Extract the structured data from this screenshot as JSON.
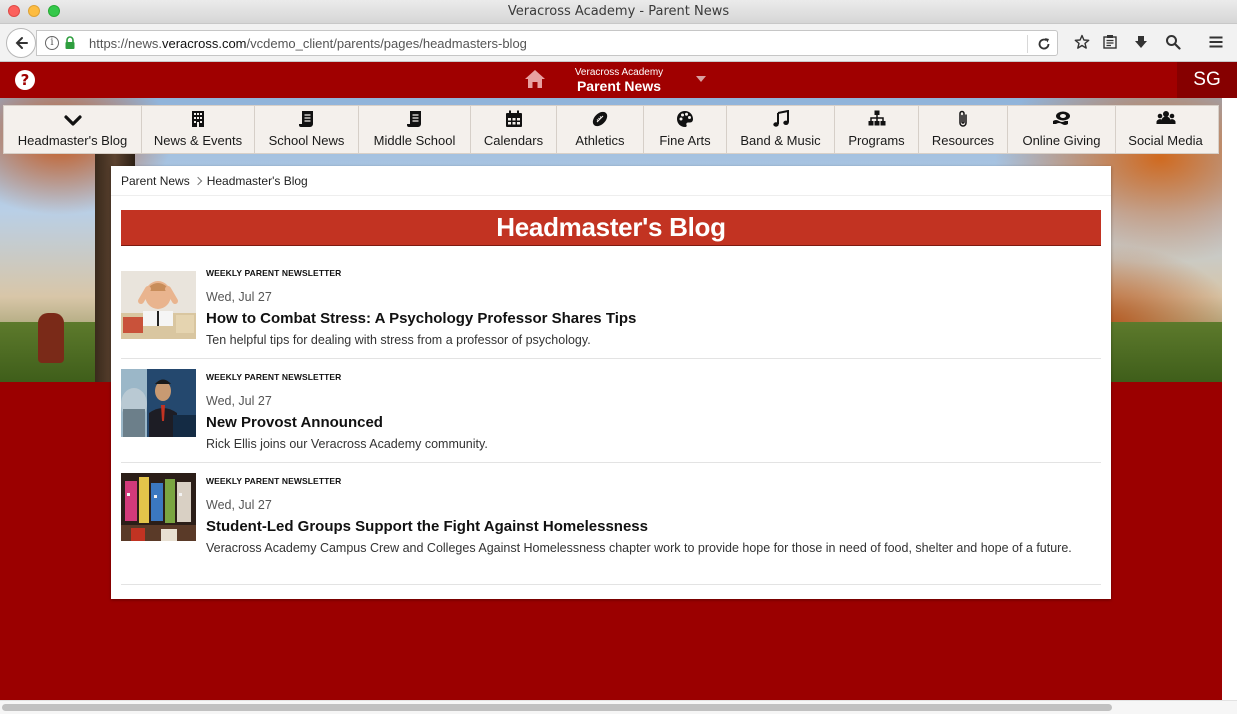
{
  "window": {
    "title": "Veracross Academy - Parent News"
  },
  "browser": {
    "url_prefix": "https://news.",
    "url_domain": "veracross.com",
    "url_path": "/vcdemo_client/parents/pages/headmasters-blog",
    "icons": [
      "back-icon",
      "info-icon",
      "lock-icon",
      "reload-icon",
      "star-icon",
      "reader-icon",
      "download-icon",
      "search-icon",
      "menu-icon"
    ]
  },
  "header": {
    "brand_small": "Veracross Academy",
    "brand_big": "Parent News",
    "avatar_initials": "SG",
    "help_glyph": "?",
    "accent": "#a00000"
  },
  "nav": {
    "items": [
      {
        "label": "Headmaster's Blog",
        "icon": "chevron-down-icon"
      },
      {
        "label": "News & Events",
        "icon": "building-icon"
      },
      {
        "label": "School News",
        "icon": "scroll-icon"
      },
      {
        "label": "Middle School",
        "icon": "scroll-icon"
      },
      {
        "label": "Calendars",
        "icon": "calendar-icon"
      },
      {
        "label": "Athletics",
        "icon": "football-icon"
      },
      {
        "label": "Fine Arts",
        "icon": "palette-icon"
      },
      {
        "label": "Band & Music",
        "icon": "music-note-icon"
      },
      {
        "label": "Programs",
        "icon": "sitemap-icon"
      },
      {
        "label": "Resources",
        "icon": "paperclip-icon"
      },
      {
        "label": "Online Giving",
        "icon": "money-icon"
      },
      {
        "label": "Social Media",
        "icon": "users-icon"
      }
    ]
  },
  "breadcrumb": {
    "root": "Parent News",
    "current": "Headmaster's Blog"
  },
  "page": {
    "title": "Headmaster's Blog",
    "title_bg": "#c23322"
  },
  "posts": [
    {
      "category": "WEEKLY PARENT NEWSLETTER",
      "date": "Wed, Jul 27",
      "title": "How to Combat Stress: A Psychology Professor Shares Tips",
      "description": "Ten helpful tips for dealing with stress from a professor of psychology."
    },
    {
      "category": "WEEKLY PARENT NEWSLETTER",
      "date": "Wed, Jul 27",
      "title": "New Provost Announced",
      "description": "Rick Ellis joins our Veracross Academy community."
    },
    {
      "category": "WEEKLY PARENT NEWSLETTER",
      "date": "Wed, Jul 27",
      "title": "Student-Led Groups Support the Fight Against Homelessness",
      "description": "Veracross Academy Campus Crew and Colleges Against Homelessness chapter work to provide hope for those in need of food, shelter and hope of a future."
    }
  ]
}
